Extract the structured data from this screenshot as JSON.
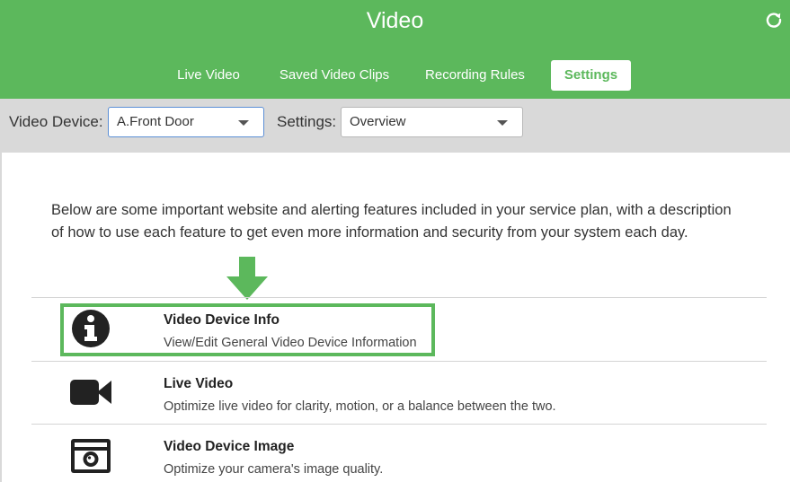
{
  "header": {
    "title": "Video",
    "refresh_icon": "refresh-icon",
    "tabs": [
      {
        "label": "Live Video"
      },
      {
        "label": "Saved Video Clips"
      },
      {
        "label": "Recording Rules"
      },
      {
        "label": "Settings",
        "active": true
      }
    ]
  },
  "toolbar": {
    "device_label": "Video Device:",
    "device_value": "A.Front Door",
    "settings_label": "Settings:",
    "settings_value": "Overview"
  },
  "content": {
    "intro": "Below are some important website and alerting features included in your service plan, with a description of how to use each feature to get even more information and security from your system each day.",
    "items": [
      {
        "title": "Video Device Info",
        "description": "View/Edit General Video Device Information",
        "icon": "info-icon",
        "highlighted": true
      },
      {
        "title": "Live Video",
        "description": "Optimize live video for clarity, motion, or a balance between the two.",
        "icon": "video-camera-icon"
      },
      {
        "title": "Video Device Image",
        "description": "Optimize your camera's image quality.",
        "icon": "camera-icon"
      }
    ]
  },
  "colors": {
    "brand_green": "#5cb85c",
    "focus_blue": "#5b8fd6"
  }
}
